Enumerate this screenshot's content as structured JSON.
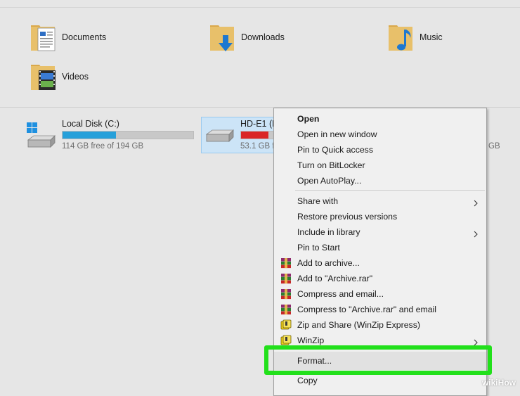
{
  "folders": [
    {
      "label": "Documents",
      "icon": "documents-folder-icon"
    },
    {
      "label": "Downloads",
      "icon": "downloads-folder-icon"
    },
    {
      "label": "Music",
      "icon": "music-folder-icon"
    },
    {
      "label": "Videos",
      "icon": "videos-folder-icon"
    }
  ],
  "drives": [
    {
      "name": "Local Disk (C:)",
      "free": "114 GB free of 194 GB",
      "used_fraction": 0.41,
      "bar_color": "#26a0da"
    },
    {
      "name": "HD-E1 (D",
      "free": "53.1 GB f",
      "used_fraction": 0.85,
      "bar_color": "#da2626"
    },
    {
      "free": "GB"
    }
  ],
  "context_menu": {
    "items": [
      {
        "label": "Open",
        "bold": true
      },
      {
        "label": "Open in new window"
      },
      {
        "label": "Pin to Quick access"
      },
      {
        "label": "Turn on BitLocker"
      },
      {
        "label": "Open AutoPlay..."
      },
      {
        "label": "Share with",
        "submenu": true
      },
      {
        "label": "Restore previous versions"
      },
      {
        "label": "Include in library",
        "submenu": true
      },
      {
        "label": "Pin to Start"
      },
      {
        "label": "Add to archive...",
        "icon": "winrar-icon"
      },
      {
        "label": "Add to \"Archive.rar\"",
        "icon": "winrar-icon"
      },
      {
        "label": "Compress and email...",
        "icon": "winrar-icon"
      },
      {
        "label": "Compress to \"Archive.rar\" and email",
        "icon": "winrar-icon"
      },
      {
        "label": "Zip and Share (WinZip Express)",
        "icon": "winzip-icon"
      },
      {
        "label": "WinZip",
        "icon": "winzip-icon",
        "submenu": true
      },
      {
        "label": "Format...",
        "highlighted": true
      },
      {
        "label": "Copy"
      }
    ]
  },
  "watermark": {
    "prefix": "wiki",
    "suffix": "How"
  },
  "colors": {
    "highlight_box": "#22e01b",
    "selection": "#cce4f7"
  }
}
